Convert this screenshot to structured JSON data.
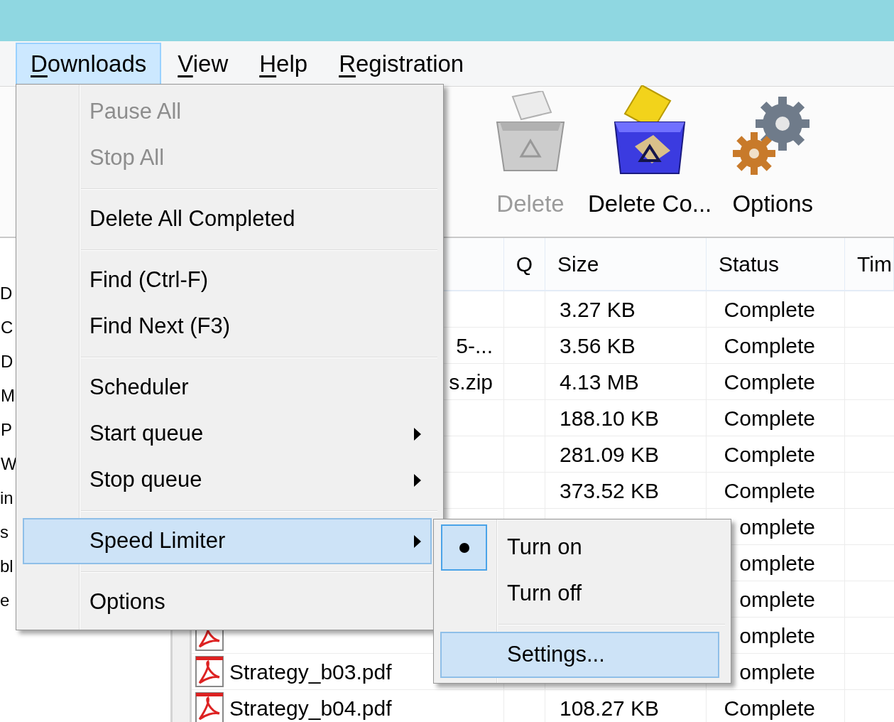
{
  "menu_bar": [
    {
      "label": "Downloads",
      "selected": true
    },
    {
      "label": "View",
      "selected": false
    },
    {
      "label": "Help",
      "selected": false
    },
    {
      "label": "Registration",
      "selected": false
    }
  ],
  "toolbar": [
    {
      "kind": "delete",
      "label": "Delete",
      "disabled": true
    },
    {
      "kind": "purge",
      "label": "Delete Co...",
      "disabled": false
    },
    {
      "kind": "options",
      "label": "Options",
      "disabled": false
    }
  ],
  "sidebar": {
    "items": [
      {
        "label": "D",
        "children": [
          {
            "label": "C"
          },
          {
            "label": "D"
          },
          {
            "label": "M"
          },
          {
            "label": "P"
          },
          {
            "label": "W"
          }
        ]
      },
      {
        "label": "in"
      },
      {
        "label": "s"
      },
      {
        "label": "bl"
      },
      {
        "label": "e"
      }
    ]
  },
  "file_list": {
    "columns": [
      "Q",
      "Size",
      "Status",
      "Tim"
    ],
    "rows": [
      {
        "size": "3.27 KB",
        "status": "Complete"
      },
      {
        "name": "5-...",
        "size": "3.56 KB",
        "status": "Complete"
      },
      {
        "name": "s.zip",
        "size": "4.13 MB",
        "status": "Complete"
      },
      {
        "size": "188.10 KB",
        "status": "Complete"
      },
      {
        "size": "281.09 KB",
        "status": "Complete"
      },
      {
        "size": "373.52 KB",
        "status": "Complete"
      },
      {
        "status": "omplete"
      },
      {
        "status": "omplete"
      },
      {
        "status": "omplete"
      },
      {
        "kind": "pdf",
        "status": "omplete"
      },
      {
        "kind": "pdf",
        "name": "Strategy_b03.pdf",
        "status": "omplete"
      },
      {
        "kind": "pdf",
        "name": "Strategy_b04.pdf",
        "size": "108.27 KB",
        "status": "Complete"
      }
    ]
  },
  "downloads_menu": {
    "items": [
      {
        "kind": "item",
        "label": "Pause All",
        "disabled": true,
        "selected": false,
        "has_submenu": false
      },
      {
        "kind": "item",
        "label": "Stop All",
        "disabled": true,
        "selected": false,
        "has_submenu": false
      },
      {
        "kind": "separator"
      },
      {
        "kind": "item",
        "label": "Delete All Completed",
        "disabled": false,
        "selected": false,
        "has_submenu": false
      },
      {
        "kind": "separator"
      },
      {
        "kind": "item",
        "label": "Find (Ctrl-F)",
        "disabled": false,
        "selected": false,
        "has_submenu": false
      },
      {
        "kind": "item",
        "label": "Find Next (F3)",
        "disabled": false,
        "selected": false,
        "has_submenu": false
      },
      {
        "kind": "separator"
      },
      {
        "kind": "item",
        "label": "Scheduler",
        "disabled": false,
        "selected": false,
        "has_submenu": false
      },
      {
        "kind": "item",
        "label": "Start queue",
        "disabled": false,
        "selected": false,
        "has_submenu": true
      },
      {
        "kind": "item",
        "label": "Stop queue",
        "disabled": false,
        "selected": false,
        "has_submenu": true
      },
      {
        "kind": "separator"
      },
      {
        "kind": "item",
        "label": "Speed Limiter",
        "disabled": false,
        "selected": true,
        "has_submenu": true
      },
      {
        "kind": "separator"
      },
      {
        "kind": "item",
        "label": "Options",
        "disabled": false,
        "selected": false,
        "has_submenu": false
      }
    ]
  },
  "speed_limiter_menu": {
    "items": [
      {
        "kind": "radio",
        "label": "Turn on",
        "checked": true,
        "selected": false
      },
      {
        "kind": "radio",
        "label": "Turn off",
        "checked": false,
        "selected": false
      },
      {
        "kind": "separator"
      },
      {
        "kind": "item",
        "label": "Settings...",
        "selected": true
      }
    ]
  }
}
